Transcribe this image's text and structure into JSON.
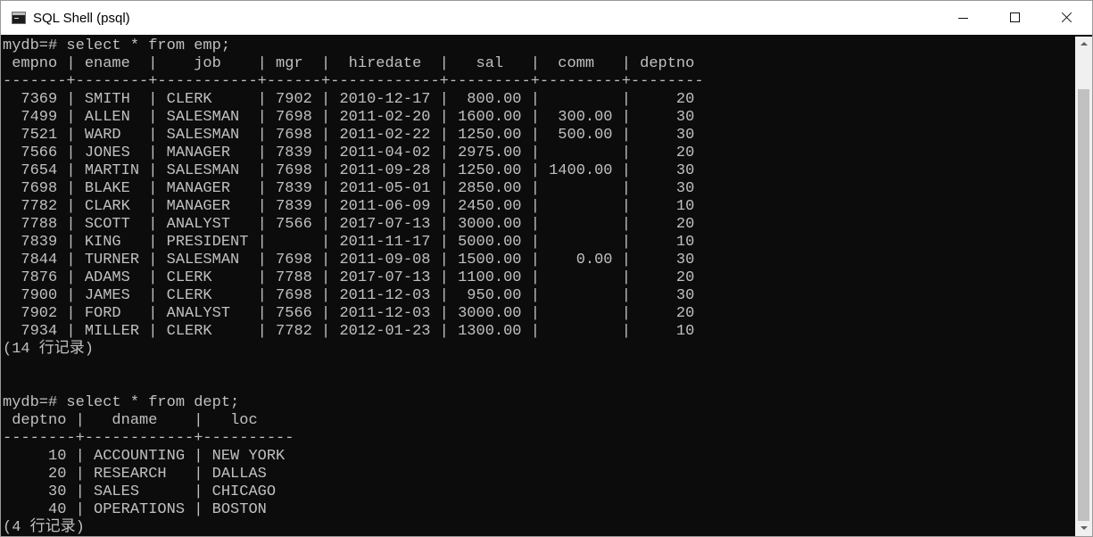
{
  "window": {
    "title": "SQL Shell (psql)",
    "icon": "terminal-icon"
  },
  "scrollbar": {
    "position": 1.0,
    "visible_fraction": 0.92
  },
  "console_lines": [
    "mydb=# select * from emp;",
    " empno | ename  |    job    | mgr  |  hiredate  |   sal   |  comm   | deptno",
    "-------+--------+-----------+------+------------+---------+---------+--------",
    "  7369 | SMITH  | CLERK     | 7902 | 2010-12-17 |  800.00 |         |     20",
    "  7499 | ALLEN  | SALESMAN  | 7698 | 2011-02-20 | 1600.00 |  300.00 |     30",
    "  7521 | WARD   | SALESMAN  | 7698 | 2011-02-22 | 1250.00 |  500.00 |     30",
    "  7566 | JONES  | MANAGER   | 7839 | 2011-04-02 | 2975.00 |         |     20",
    "  7654 | MARTIN | SALESMAN  | 7698 | 2011-09-28 | 1250.00 | 1400.00 |     30",
    "  7698 | BLAKE  | MANAGER   | 7839 | 2011-05-01 | 2850.00 |         |     30",
    "  7782 | CLARK  | MANAGER   | 7839 | 2011-06-09 | 2450.00 |         |     10",
    "  7788 | SCOTT  | ANALYST   | 7566 | 2017-07-13 | 3000.00 |         |     20",
    "  7839 | KING   | PRESIDENT |      | 2011-11-17 | 5000.00 |         |     10",
    "  7844 | TURNER | SALESMAN  | 7698 | 2011-09-08 | 1500.00 |    0.00 |     30",
    "  7876 | ADAMS  | CLERK     | 7788 | 2017-07-13 | 1100.00 |         |     20",
    "  7900 | JAMES  | CLERK     | 7698 | 2011-12-03 |  950.00 |         |     30",
    "  7902 | FORD   | ANALYST   | 7566 | 2011-12-03 | 3000.00 |         |     20",
    "  7934 | MILLER | CLERK     | 7782 | 2012-01-23 | 1300.00 |         |     10",
    "(14 行记录)",
    "",
    "",
    "mydb=# select * from dept;",
    " deptno |   dname    |   loc",
    "--------+------------+----------",
    "     10 | ACCOUNTING | NEW YORK",
    "     20 | RESEARCH   | DALLAS",
    "     30 | SALES      | CHICAGO",
    "     40 | OPERATIONS | BOSTON",
    "(4 行记录)"
  ]
}
